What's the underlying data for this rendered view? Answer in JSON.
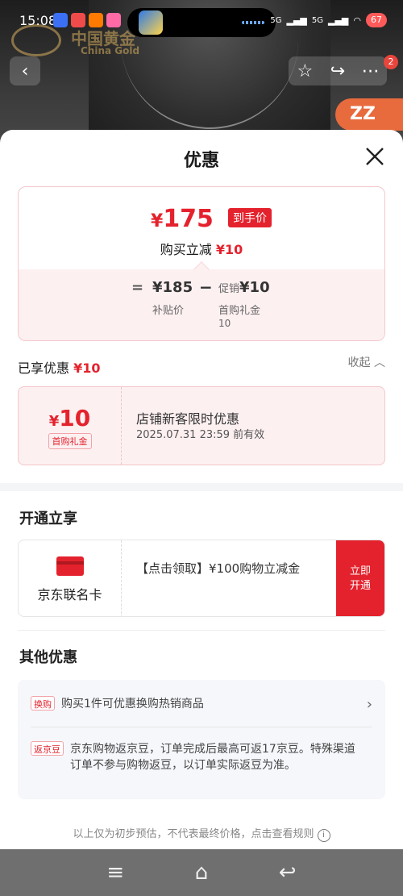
{
  "status_bar": {
    "time": "15:08",
    "signal_1": "5G",
    "signal_2": "5G",
    "battery": "67",
    "app_icons": [
      {
        "name": "wps-icon",
        "color": "#3b6ff5"
      },
      {
        "name": "weibo-icon",
        "color": "#f04b4b"
      },
      {
        "name": "taobao-icon",
        "color": "#ff7a00"
      },
      {
        "name": "bilibili-icon",
        "color": "#ff6aa6"
      }
    ]
  },
  "background": {
    "watermark_cn": "中国黄金",
    "watermark_en": "China Gold",
    "corner_tag": "ZZ",
    "more_badge": "2"
  },
  "sheet": {
    "title": "优惠",
    "summary": {
      "currency": "¥",
      "final_price": "175",
      "final_tag": "到手价",
      "reduce_label": "购买立减",
      "reduce_amount": "¥10",
      "calc_equals": "=",
      "subsidy_price": "¥185",
      "subsidy_label": "补贴价",
      "minus": "−",
      "promo_prefix": "促销",
      "promo_amount": "¥10",
      "promo_label": "首购礼金",
      "promo_value": "10"
    },
    "enjoyed": {
      "label": "已享优惠",
      "amount": "¥10",
      "collapse": "收起"
    },
    "coupon": {
      "currency": "¥",
      "amount": "10",
      "tag": "首购礼金",
      "title": "店铺新客限时优惠",
      "expiry": "2025.07.31 23:59 前有效"
    },
    "open_section": {
      "title": "开通立享",
      "card_name": "京东联名卡",
      "card_desc": "【点击领取】¥100购物立减金",
      "button": "立即开通"
    },
    "other_section": {
      "title": "其他优惠",
      "items": [
        {
          "tag": "换购",
          "text": "购买1件可优惠换购热销商品"
        },
        {
          "tag": "返京豆",
          "text": "京东购物返京豆，订单完成后最高可返17京豆。特殊渠道订单不参与购物返豆，以订单实际返豆为准。"
        }
      ]
    },
    "footnote": "以上仅为初步预估，不代表最终价格，点击查看规则"
  },
  "colors": {
    "accent_red": "#e4222d",
    "pink_bg": "#fdf0f1"
  }
}
